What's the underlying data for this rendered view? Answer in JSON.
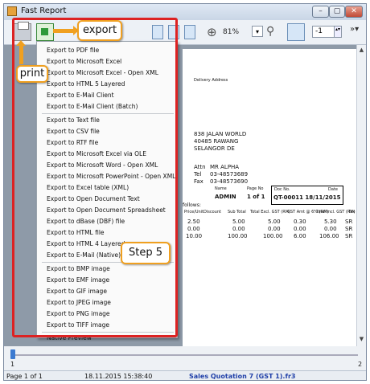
{
  "window": {
    "title": "Fast Report"
  },
  "title_buttons": {
    "minimize": "–",
    "maximize": "▢",
    "close": "✕"
  },
  "toolbar": {
    "zoom": "81%",
    "zoom_dropdown": "▾",
    "page_number": "-1",
    "spin": "▴▾",
    "overflow": "»▾",
    "icons": [
      "print-icon",
      "export-icon",
      "page-icon",
      "zoom-icon",
      "search-icon",
      "edit-icon"
    ]
  },
  "export_menu": {
    "items": [
      "Export to PDF file",
      "Export to Microsoft Excel",
      "Export to Microsoft Excel - Open XML",
      "Export to HTML 5 Layered",
      "Export to E-Mail Client",
      "Export to E-Mail Client (Batch)",
      "Export to Text file",
      "Export to CSV file",
      "Export to RTF file",
      "Export to Microsoft Excel via OLE",
      "Export to Microsoft Word - Open XML",
      "Export to Microsoft PowerPoint - Open XML",
      "Export to Excel table (XML)",
      "Export to Open Document Text",
      "Export to Open Document Spreadsheet",
      "Export to dBase (DBF) file",
      "Export to HTML file",
      "Export to HTML 4 Layered",
      "Export to E-Mail (Native)",
      "Export to BMP image",
      "Export to EMF image",
      "Export to GIF image",
      "Export to JPEG image",
      "Export to PNG image",
      "Export to TIFF image",
      "Native Preview"
    ]
  },
  "callouts": {
    "export": "export",
    "print": "print",
    "step5": "Step 5"
  },
  "document": {
    "delivery_address_label": "Delivery Address",
    "address": [
      "838 JALAN WORLD",
      "40485 RAWANG",
      "SELANGOR DE"
    ],
    "attn_label": "Attn",
    "attn": "MR ALPHA",
    "tel_label": "Tel",
    "tel": "03-48573689",
    "fax_label": "Fax",
    "fax": "03-48573690",
    "name_label": "Name",
    "name": "ADMIN",
    "page_no_label": "Page No",
    "page_no": "1 of 1",
    "doc_no_label": "Doc No.",
    "date_label": "Date",
    "quote_no": "QT-00011 18/11/2015",
    "follows": "follows:",
    "headers": [
      "Price/Unit",
      "Discount",
      "Sub Total",
      "Total Excl. GST (RM)",
      "GST Amt @ 6% (RM)",
      "Total Incl. GST (RM)",
      "Tax"
    ],
    "rows": [
      [
        "2.50",
        "",
        "5.00",
        "5.00",
        "0.30",
        "5.30",
        "SR"
      ],
      [
        "0.00",
        "",
        "0.00",
        "0.00",
        "0.00",
        "0.00",
        "SR"
      ],
      [
        "10.00",
        "",
        "100.00",
        "100.00",
        "6.00",
        "106.00",
        "SR"
      ]
    ]
  },
  "hscroll": {
    "left_label": "1",
    "right_label": "2"
  },
  "status": {
    "page": "Page 1 of 1",
    "datetime": "18.11.2015 15:38:40",
    "file": "Sales Quotation 7 (GST 1).fr3"
  }
}
